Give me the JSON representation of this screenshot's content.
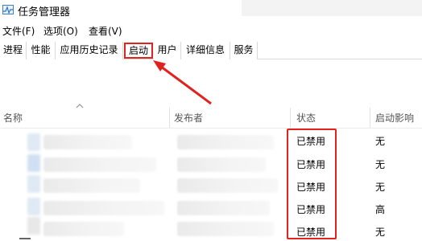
{
  "window": {
    "title": "任务管理器"
  },
  "menu": [
    {
      "label": "文件(F)"
    },
    {
      "label": "选项(O)"
    },
    {
      "label": "查看(V)"
    }
  ],
  "tabs": [
    {
      "label": "进程"
    },
    {
      "label": "性能"
    },
    {
      "label": "应用历史记录"
    },
    {
      "label": "启动",
      "active": true
    },
    {
      "label": "用户"
    },
    {
      "label": "详细信息"
    },
    {
      "label": "服务"
    }
  ],
  "columns": {
    "name": "名称",
    "publisher": "发布者",
    "status": "状态",
    "impact": "启动影响"
  },
  "rows": [
    {
      "status": "已禁用",
      "impact": "无"
    },
    {
      "status": "已禁用",
      "impact": "无"
    },
    {
      "status": "已禁用",
      "impact": "无"
    },
    {
      "status": "已禁用",
      "impact": "高"
    },
    {
      "status": "已禁用",
      "impact": "无"
    }
  ],
  "colors": {
    "highlight": "#e0231e",
    "tab_border": "#d9d9d9"
  },
  "icons": {
    "app": "task-manager-icon",
    "sort": "sort-ascending-caret-icon",
    "annotation": "red-arrow"
  }
}
